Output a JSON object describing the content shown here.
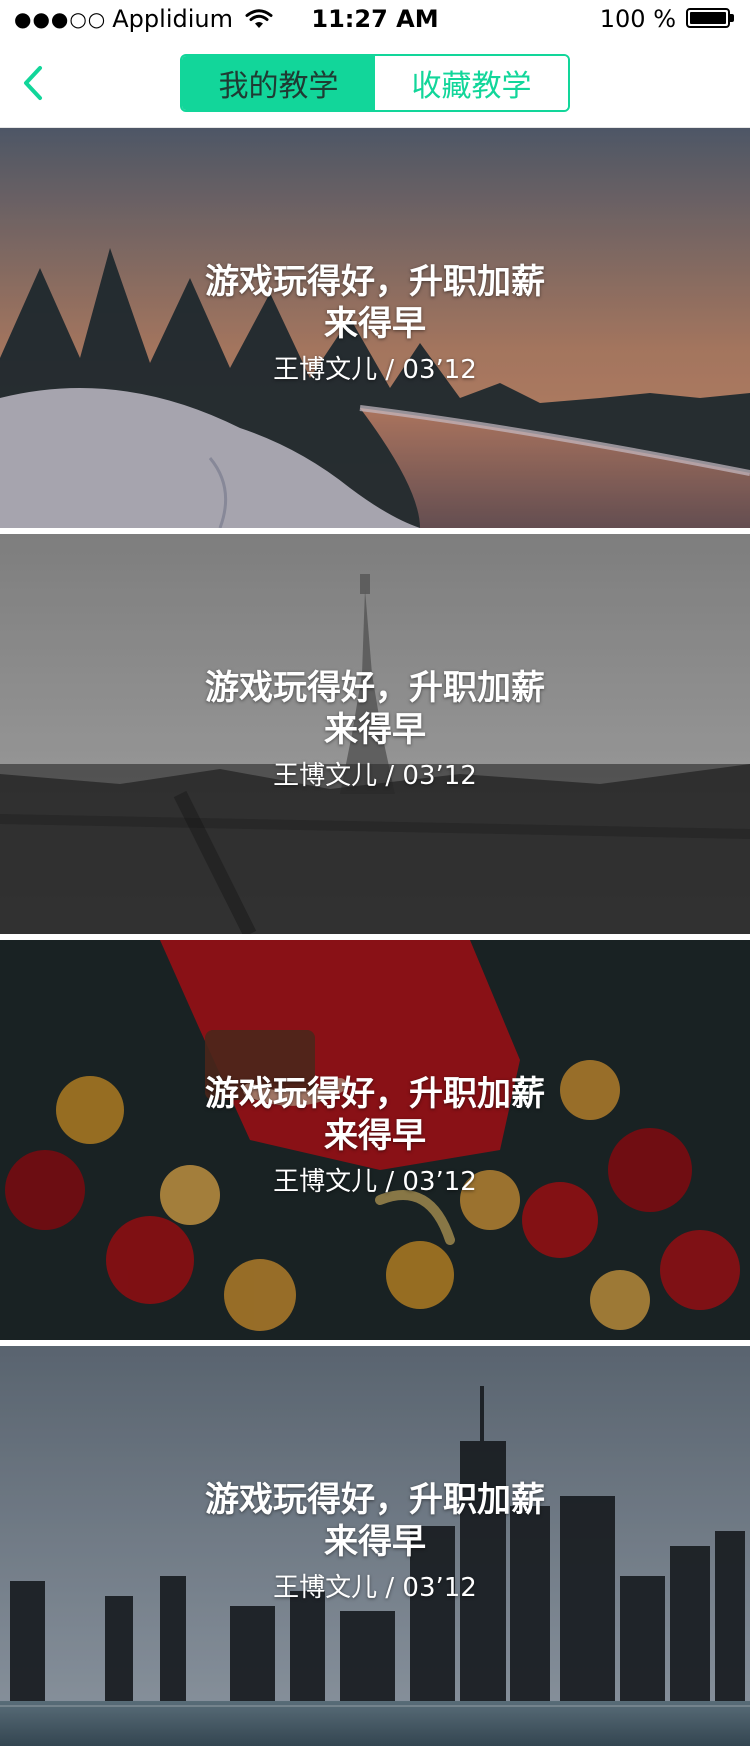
{
  "status_bar": {
    "carrier": "Applidium",
    "time": "11:27 AM",
    "battery": "100 %",
    "signal": "●●●○○",
    "wifi_icon": "wifi-icon",
    "battery_icon": "battery-icon"
  },
  "nav": {
    "back_icon": "chevron-left-icon",
    "tabs": [
      {
        "label": "我的教学",
        "active": true
      },
      {
        "label": "收藏教学",
        "active": false
      }
    ],
    "accent_color": "#12d69a"
  },
  "cards": [
    {
      "title": "游戏玩得好，升职加薪来得早",
      "meta": "王博文儿 / 03’12",
      "theme": "snowy-sunset-river"
    },
    {
      "title": "游戏玩得好，升职加薪来得早",
      "meta": "王博文儿 / 03’12",
      "theme": "foggy-paris-eiffel"
    },
    {
      "title": "游戏玩得好，升职加薪来得早",
      "meta": "王博文儿 / 03’12",
      "theme": "red-dress-roses"
    },
    {
      "title": "游戏玩得好，升职加薪来得早",
      "meta": "王博文儿 / 03’12",
      "theme": "city-skyline-waterfront"
    }
  ]
}
